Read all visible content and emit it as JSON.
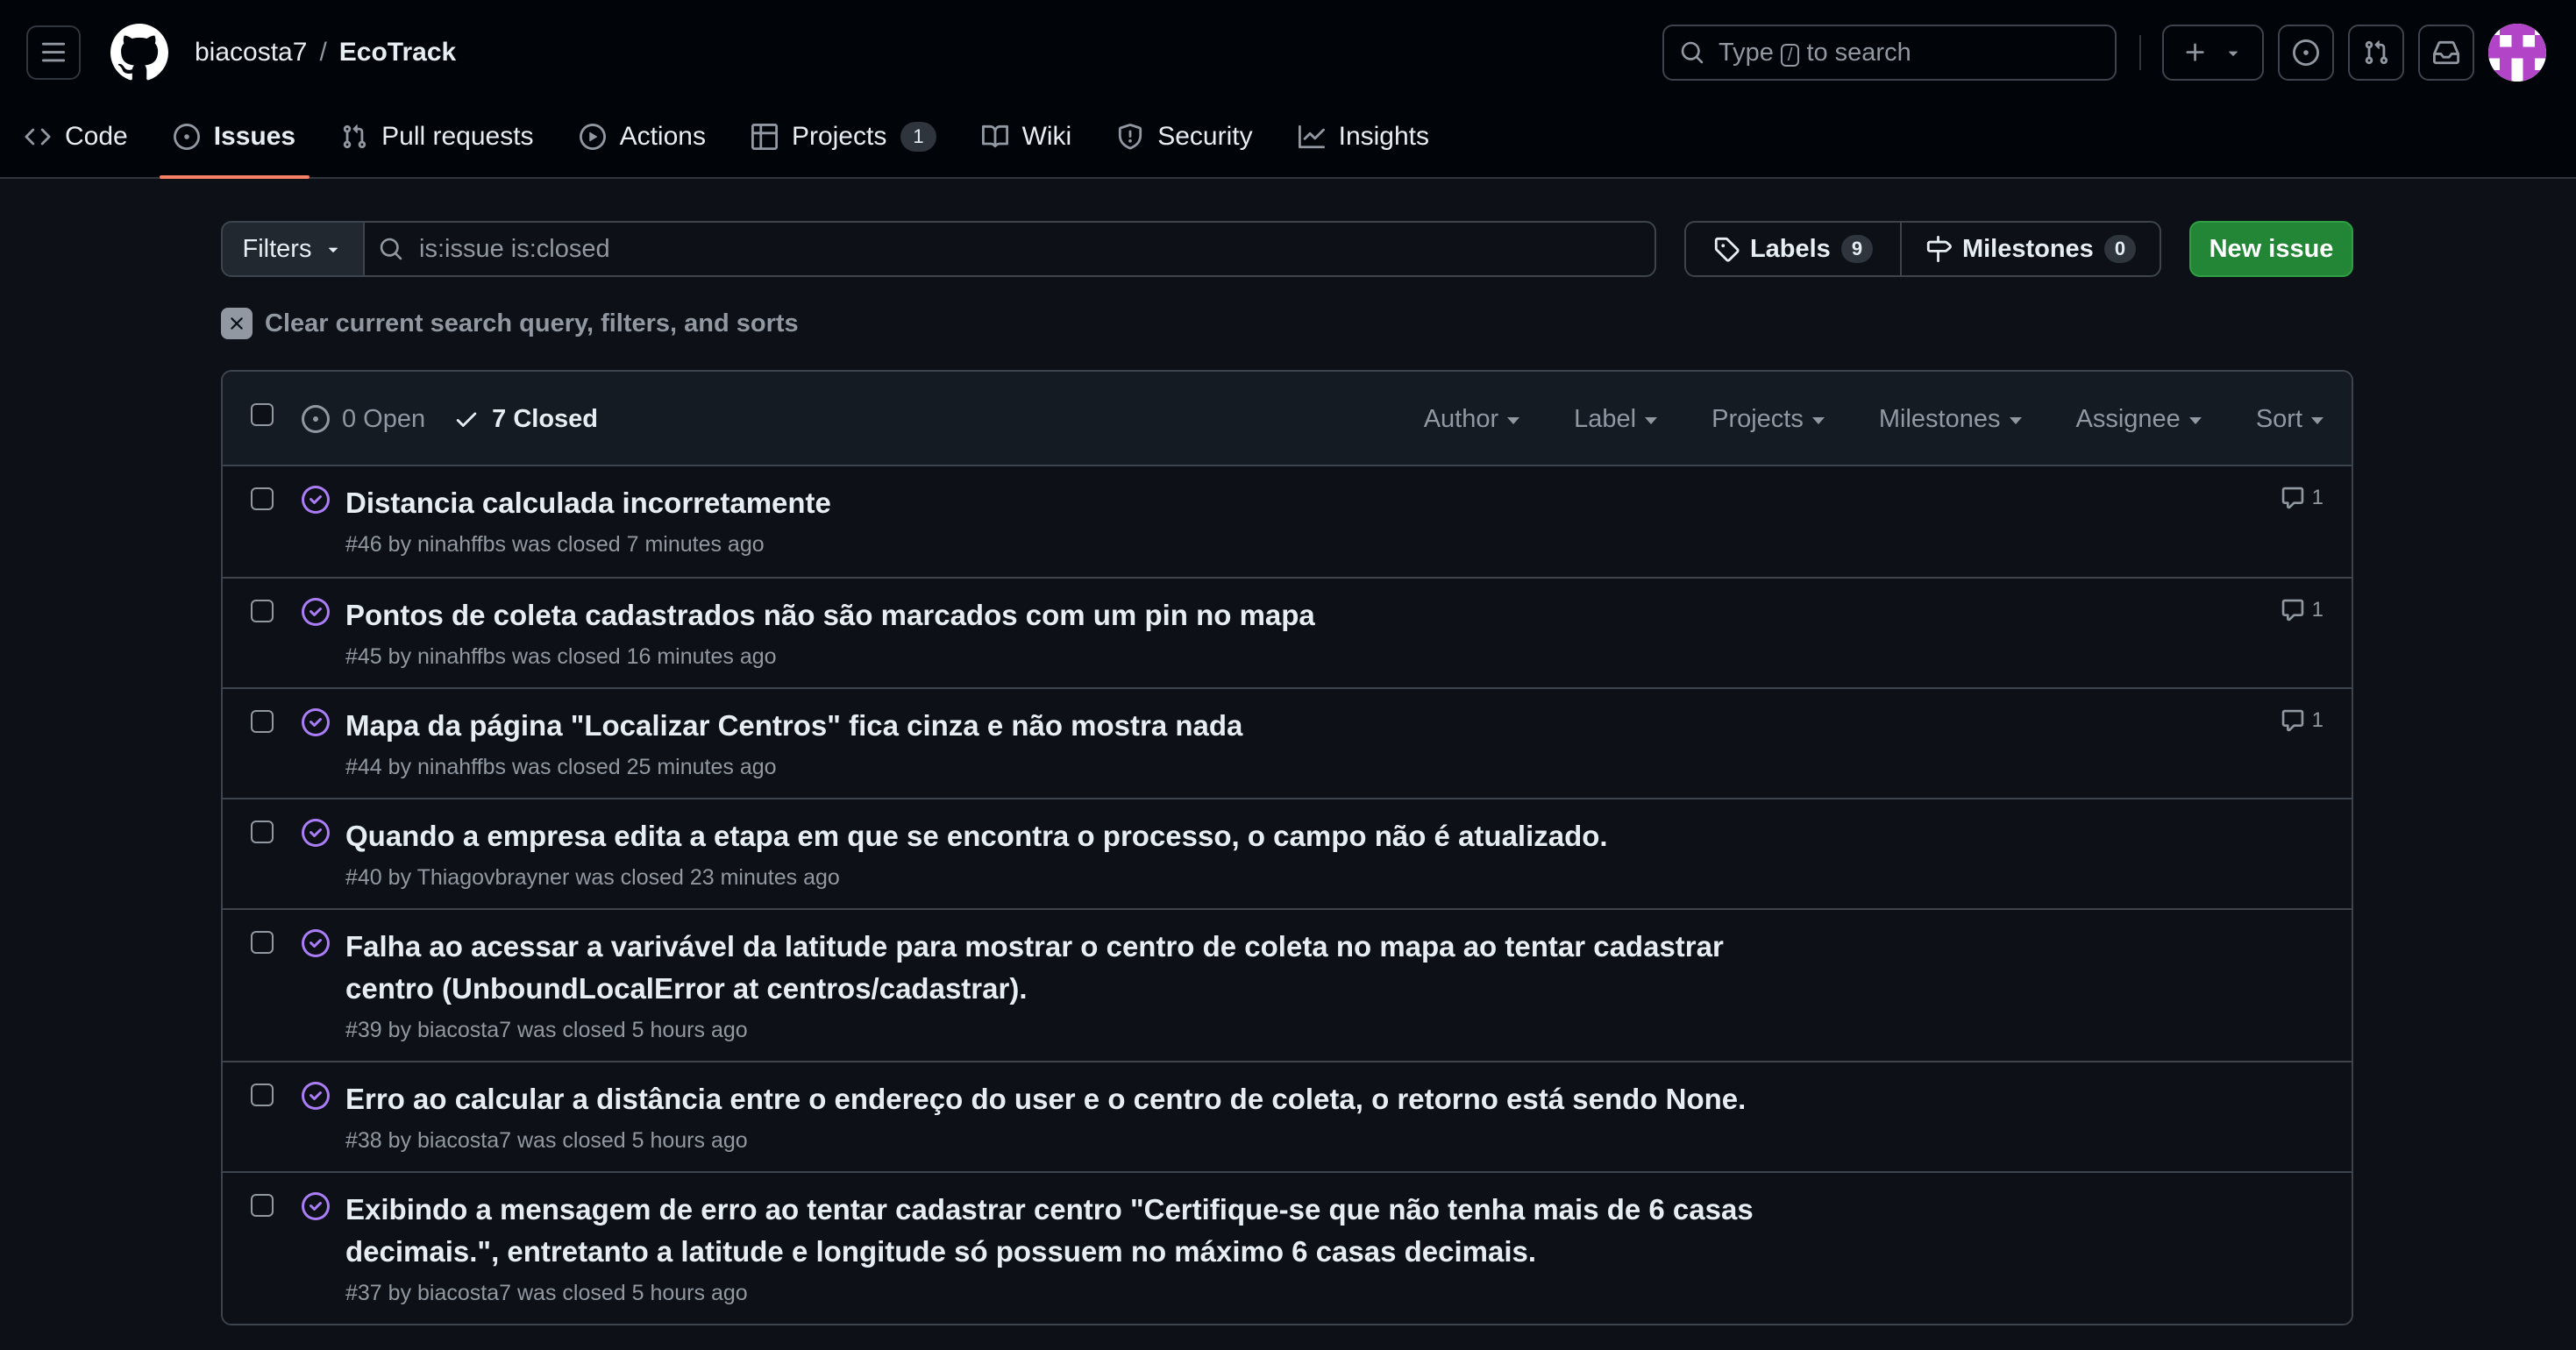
{
  "header": {
    "owner": "biacosta7",
    "separator": "/",
    "repo": "EcoTrack",
    "search": {
      "prefix": "Type",
      "key": "/",
      "suffix": "to search"
    }
  },
  "repo_nav": [
    {
      "label": "Code",
      "icon": "code-icon"
    },
    {
      "label": "Issues",
      "icon": "issue-opened-icon",
      "active": true
    },
    {
      "label": "Pull requests",
      "icon": "git-pull-request-icon"
    },
    {
      "label": "Actions",
      "icon": "play-icon"
    },
    {
      "label": "Projects",
      "icon": "table-icon",
      "count": "1"
    },
    {
      "label": "Wiki",
      "icon": "book-icon"
    },
    {
      "label": "Security",
      "icon": "shield-icon"
    },
    {
      "label": "Insights",
      "icon": "graph-icon"
    }
  ],
  "subnav": {
    "filters_label": "Filters",
    "query": "is:issue is:closed",
    "labels_label": "Labels",
    "labels_count": "9",
    "milestones_label": "Milestones",
    "milestones_count": "0",
    "new_issue_label": "New issue",
    "clear_label": "Clear current search query, filters, and sorts"
  },
  "list_header": {
    "open_label": "0 Open",
    "closed_label": "7 Closed",
    "filters": [
      "Author",
      "Label",
      "Projects",
      "Milestones",
      "Assignee",
      "Sort"
    ]
  },
  "issues": [
    {
      "title": "Distancia calculada incorretamente",
      "number": "#46",
      "author": "ninahffbs",
      "closed": "was closed 7 minutes ago",
      "comments": "1"
    },
    {
      "title": "Pontos de coleta cadastrados não são marcados com um pin no mapa",
      "number": "#45",
      "author": "ninahffbs",
      "closed": "was closed 16 minutes ago",
      "comments": "1"
    },
    {
      "title": "Mapa da página \"Localizar Centros\" fica cinza e não mostra nada",
      "number": "#44",
      "author": "ninahffbs",
      "closed": "was closed 25 minutes ago",
      "comments": "1"
    },
    {
      "title": "Quando a empresa edita a etapa em que se encontra o processo, o campo não é atualizado.",
      "number": "#40",
      "author": "Thiagovbrayner",
      "closed": "was closed 23 minutes ago",
      "comments": ""
    },
    {
      "title": "Falha ao acessar a varivável da latitude para mostrar o centro de coleta no mapa ao tentar cadastrar centro (UnboundLocalError at centros/cadastrar).",
      "number": "#39",
      "author": "biacosta7",
      "closed": "was closed 5 hours ago",
      "comments": ""
    },
    {
      "title": "Erro ao calcular a distância entre o endereço do user e o centro de coleta, o retorno está sendo None.",
      "number": "#38",
      "author": "biacosta7",
      "closed": "was closed 5 hours ago",
      "comments": ""
    },
    {
      "title": "Exibindo a mensagem de erro ao tentar cadastrar centro \"Certifique-se que não tenha mais de 6 casas decimais.\", entretanto a latitude e longitude só possuem no máximo 6 casas decimais.",
      "number": "#37",
      "author": "biacosta7",
      "closed": "was closed 5 hours ago",
      "comments": ""
    }
  ],
  "colors": {
    "closed_icon": "#ab7df8",
    "accent_underline": "#f78166",
    "new_issue_bg": "#238636"
  }
}
